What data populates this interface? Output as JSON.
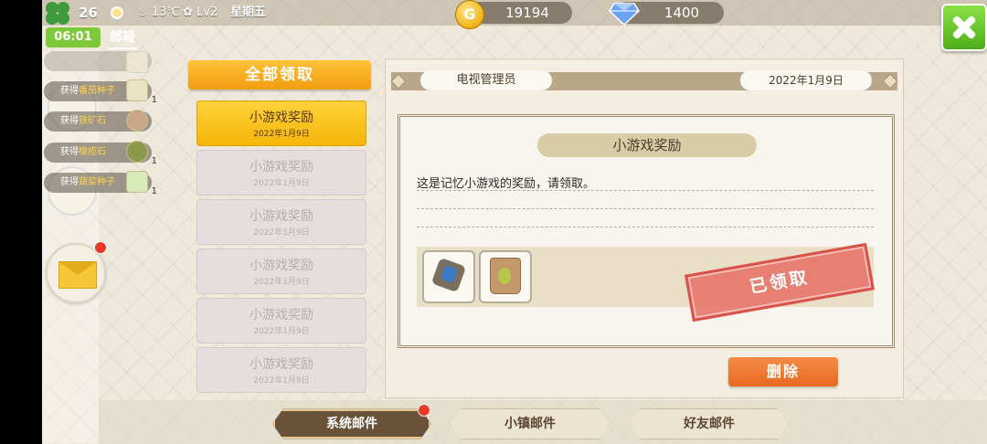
{
  "topbar": {
    "level": "26",
    "temperature": "13℃",
    "weather_level": "Lv2",
    "weekday": "星期五",
    "gold": "19194",
    "gold_icon_letter": "G",
    "diamonds": "1400",
    "time": "06:01",
    "mailbox_label": "邮箱"
  },
  "notifications": [
    {
      "prefix": "获得",
      "item": "番茄种子",
      "count": "1"
    },
    {
      "prefix": "获得",
      "item": "铁矿石",
      "count": ""
    },
    {
      "prefix": "获得",
      "item": "橄榄石",
      "count": "1"
    },
    {
      "prefix": "获得",
      "item": "蔬菜种子",
      "count": "1"
    }
  ],
  "mail_list": {
    "collect_all_label": "全部领取",
    "items": [
      {
        "title": "小游戏奖励",
        "date": "2022年1月9日"
      },
      {
        "title": "小游戏奖励",
        "date": "2022年1月9日"
      },
      {
        "title": "小游戏奖励",
        "date": "2022年1月9日"
      },
      {
        "title": "小游戏奖励",
        "date": "2022年1月9日"
      },
      {
        "title": "小游戏奖励",
        "date": "2022年1月9日"
      },
      {
        "title": "小游戏奖励",
        "date": "2022年1月9日"
      }
    ]
  },
  "detail": {
    "sender": "电视管理员",
    "date": "2022年1月9日",
    "subject": "小游戏奖励",
    "body": "这是记忆小游戏的奖励，请领取。",
    "claimed_stamp": "已领取",
    "delete_label": "删除",
    "rewards": [
      "ore-icon",
      "seed-bag-icon"
    ]
  },
  "tabs": [
    {
      "label": "系统邮件",
      "active": true
    },
    {
      "label": "小镇邮件",
      "active": false
    },
    {
      "label": "好友邮件",
      "active": false
    }
  ],
  "colors": {
    "accent_orange": "#f29c10",
    "claimed_red": "#d9534a",
    "active_tab": "#6a513a"
  }
}
